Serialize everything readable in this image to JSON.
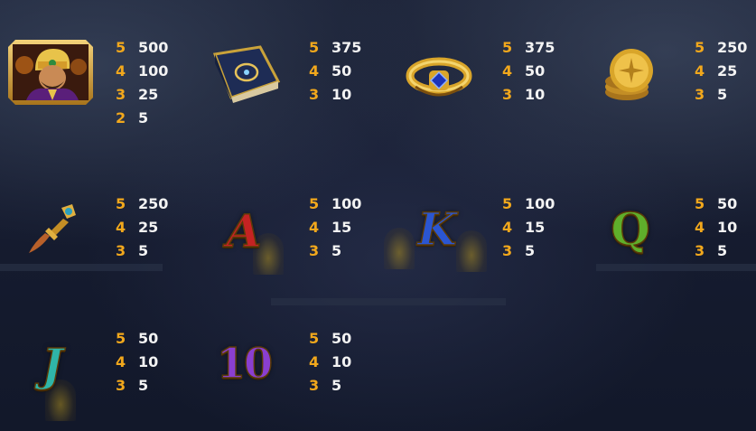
{
  "colors": {
    "count": "#f2a81c",
    "value": "#f3f3f3",
    "background": "#161c30",
    "gold": "#d9a52a"
  },
  "symbols": [
    {
      "name": "vizier",
      "icon": "vizier-icon",
      "pays": [
        {
          "count": "5",
          "value": "500"
        },
        {
          "count": "4",
          "value": "100"
        },
        {
          "count": "3",
          "value": "25"
        },
        {
          "count": "2",
          "value": "5"
        }
      ]
    },
    {
      "name": "spell book",
      "icon": "book-icon",
      "pays": [
        {
          "count": "5",
          "value": "375"
        },
        {
          "count": "4",
          "value": "50"
        },
        {
          "count": "3",
          "value": "10"
        }
      ]
    },
    {
      "name": "ring",
      "icon": "ring-icon",
      "pays": [
        {
          "count": "5",
          "value": "375"
        },
        {
          "count": "4",
          "value": "50"
        },
        {
          "count": "3",
          "value": "10"
        }
      ]
    },
    {
      "name": "gold coins",
      "icon": "coins-icon",
      "pays": [
        {
          "count": "5",
          "value": "250"
        },
        {
          "count": "4",
          "value": "25"
        },
        {
          "count": "3",
          "value": "5"
        }
      ]
    },
    {
      "name": "dagger",
      "icon": "dagger-icon",
      "pays": [
        {
          "count": "5",
          "value": "250"
        },
        {
          "count": "4",
          "value": "25"
        },
        {
          "count": "3",
          "value": "5"
        }
      ]
    },
    {
      "name": "A",
      "glyph": "A",
      "icon": "letter-a-icon",
      "pays": [
        {
          "count": "5",
          "value": "100"
        },
        {
          "count": "4",
          "value": "15"
        },
        {
          "count": "3",
          "value": "5"
        }
      ]
    },
    {
      "name": "K",
      "glyph": "K",
      "icon": "letter-k-icon",
      "pays": [
        {
          "count": "5",
          "value": "100"
        },
        {
          "count": "4",
          "value": "15"
        },
        {
          "count": "3",
          "value": "5"
        }
      ]
    },
    {
      "name": "Q",
      "glyph": "Q",
      "icon": "letter-q-icon",
      "pays": [
        {
          "count": "5",
          "value": "50"
        },
        {
          "count": "4",
          "value": "10"
        },
        {
          "count": "3",
          "value": "5"
        }
      ]
    },
    {
      "name": "J",
      "glyph": "J",
      "icon": "letter-j-icon",
      "pays": [
        {
          "count": "5",
          "value": "50"
        },
        {
          "count": "4",
          "value": "10"
        },
        {
          "count": "3",
          "value": "5"
        }
      ]
    },
    {
      "name": "10",
      "glyph": "10",
      "icon": "number-10-icon",
      "pays": [
        {
          "count": "5",
          "value": "50"
        },
        {
          "count": "4",
          "value": "10"
        },
        {
          "count": "3",
          "value": "5"
        }
      ]
    }
  ]
}
